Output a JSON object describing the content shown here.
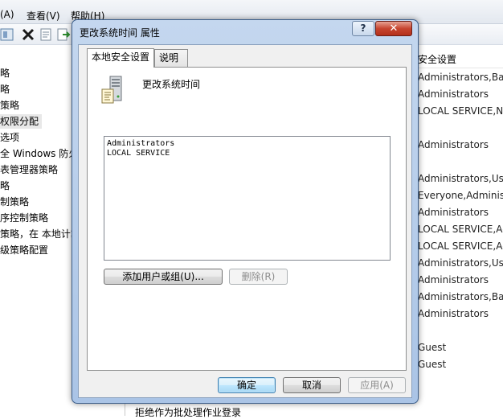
{
  "menubar": {
    "items": [
      "(A)",
      "查看(V)",
      "帮助(H)"
    ]
  },
  "left_tree": {
    "items": [
      {
        "label": "略",
        "selected": false
      },
      {
        "label": "略",
        "selected": false
      },
      {
        "label": "策略",
        "selected": false
      },
      {
        "label": "权限分配",
        "selected": true
      },
      {
        "label": "选项",
        "selected": false
      },
      {
        "label": "全 Windows 防火",
        "selected": false
      },
      {
        "label": "表管理器策略",
        "selected": false
      },
      {
        "label": "略",
        "selected": false
      },
      {
        "label": "制策略",
        "selected": false
      },
      {
        "label": "序控制策略",
        "selected": false
      },
      {
        "label": "策略，在 本地计算",
        "selected": false
      },
      {
        "label": "级策略配置",
        "selected": false
      }
    ]
  },
  "right_pane": {
    "header": "安全设置",
    "rows": [
      "Administrators,Bac",
      "Administrators",
      "LOCAL SERVICE,NE",
      "",
      "Administrators",
      "",
      "Administrators,Use",
      "Everyone,Administr",
      "Administrators",
      "LOCAL SERVICE,Ad",
      "LOCAL SERVICE,Ad",
      "Administrators,Use",
      "Administrators",
      "Administrators,Bac",
      "Administrators",
      "",
      "Guest",
      "Guest"
    ]
  },
  "bottom_strip_text": "拒绝作为批处理作业登录",
  "dialog": {
    "title": "更改系统时间 属性",
    "help_label": "?",
    "close_label": "✕",
    "tabs": [
      "本地安全设置",
      "说明"
    ],
    "policy_name": "更改系统时间",
    "principals": [
      "Administrators",
      "LOCAL SERVICE"
    ],
    "buttons": {
      "add": "添加用户或组(U)...",
      "remove": "删除(R)",
      "ok": "确定",
      "cancel": "取消",
      "apply": "应用(A)"
    }
  },
  "colors": {
    "accent": "#3c7fb1",
    "title_bar": "#aac4e6",
    "close": "#c7452f"
  }
}
